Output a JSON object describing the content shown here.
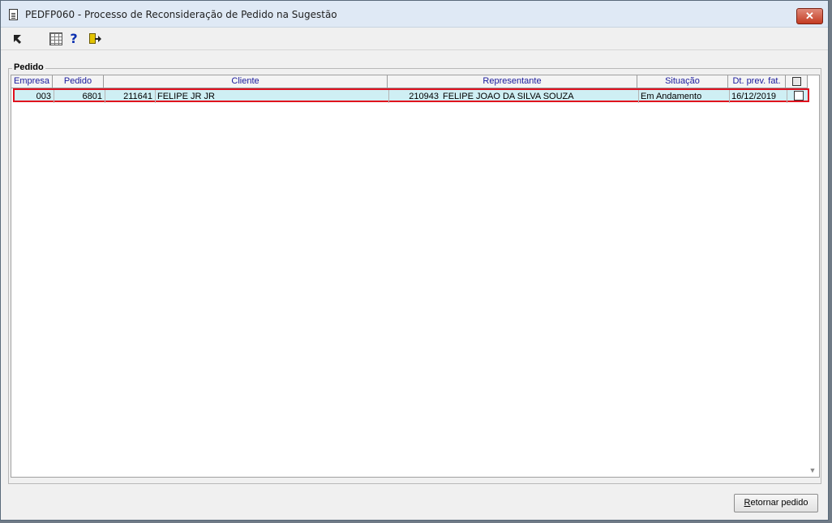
{
  "window": {
    "title": "PEDFP060 - Processo de Reconsideração de Pedido na Sugestão",
    "close_label": "✕"
  },
  "toolbar": {
    "icons": [
      "cursor-icon",
      "grid-icon",
      "help-icon",
      "exit-icon"
    ],
    "help_glyph": "?"
  },
  "group": {
    "label": "Pedido"
  },
  "table": {
    "columns": [
      "Empresa",
      "Pedido",
      "Cliente",
      "Representante",
      "Situação",
      "Dt. prev. fat."
    ],
    "rows": [
      {
        "empresa": "003",
        "pedido": "6801",
        "cliente_codigo": "211641",
        "cliente_nome": "FELIPE JR JR",
        "representante_codigo": "210943",
        "representante_nome": "FELIPE JOAO DA SILVA SOUZA",
        "situacao": "Em Andamento",
        "dt_prev_fat": "16/12/2019",
        "selected": false
      }
    ],
    "select_all": false
  },
  "footer": {
    "retornar_prefix": "R",
    "retornar_rest": "etornar pedido"
  },
  "colors": {
    "selection_border": "#e0101e",
    "row_bg": "#cfeff4",
    "header_text": "#1a1a9c"
  }
}
